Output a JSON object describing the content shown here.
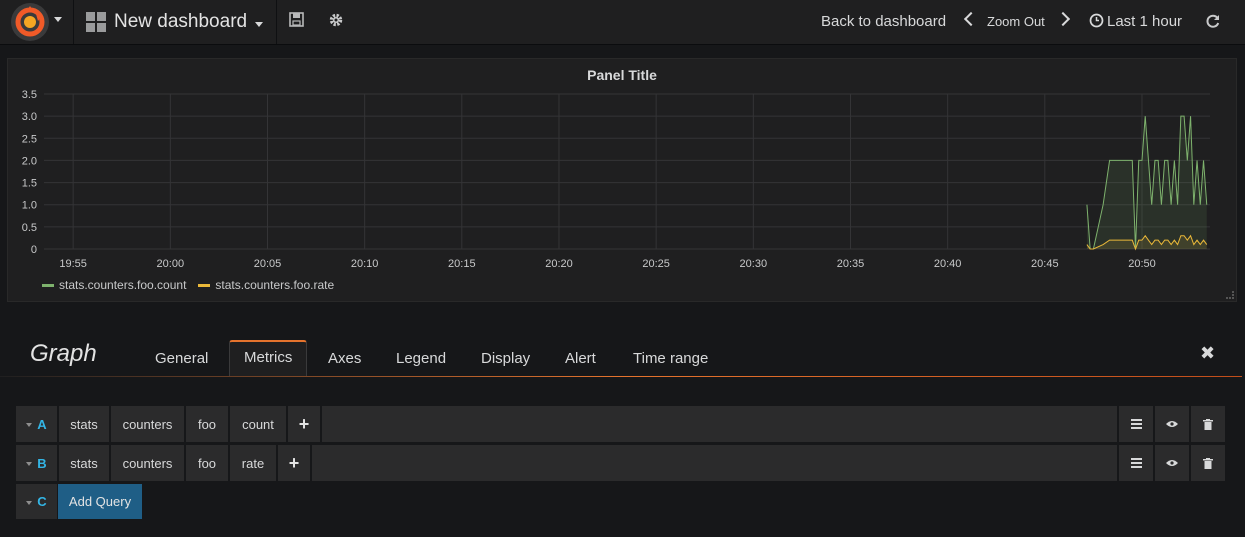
{
  "navbar": {
    "dashboard_title": "New dashboard",
    "back_to_dashboard": "Back to dashboard",
    "zoom_out": "Zoom Out",
    "time_range": "Last 1 hour"
  },
  "panel": {
    "title": "Panel Title"
  },
  "chart_data": {
    "type": "line",
    "title": "Panel Title",
    "xlabel": "",
    "ylabel": "",
    "x_ticks": [
      "19:55",
      "20:00",
      "20:05",
      "20:10",
      "20:15",
      "20:20",
      "20:25",
      "20:30",
      "20:35",
      "20:40",
      "20:45",
      "20:50"
    ],
    "y_ticks": [
      "0",
      "0.5",
      "1.0",
      "1.5",
      "2.0",
      "2.5",
      "3.0",
      "3.5"
    ],
    "ylim": [
      0,
      3.5
    ],
    "xlim": [
      "19:53:30",
      "20:53:30"
    ],
    "grid": true,
    "legend_position": "bottom-left",
    "series": [
      {
        "name": "stats.counters.foo.count",
        "color": "#7eb26d",
        "x": [
          "20:47:10",
          "20:47:20",
          "20:47:30",
          "20:48:00",
          "20:48:20",
          "20:48:30",
          "20:49:00",
          "20:49:30",
          "20:49:40",
          "20:49:50",
          "20:50:00",
          "20:50:10",
          "20:50:20",
          "20:50:30",
          "20:50:40",
          "20:50:50",
          "20:51:00",
          "20:51:10",
          "20:51:20",
          "20:51:30",
          "20:51:40",
          "20:51:50",
          "20:52:00",
          "20:52:10",
          "20:52:20",
          "20:52:30",
          "20:52:40",
          "20:52:50",
          "20:53:00",
          "20:53:10",
          "20:53:20"
        ],
        "y": [
          1,
          0,
          0,
          1,
          2,
          2,
          2,
          2,
          0,
          2,
          2,
          3,
          2,
          1,
          2,
          2,
          1,
          2,
          2,
          1,
          2,
          1,
          3,
          3,
          2,
          3,
          1,
          2,
          1,
          2,
          1
        ]
      },
      {
        "name": "stats.counters.foo.rate",
        "color": "#eab839",
        "x": [
          "20:47:10",
          "20:47:20",
          "20:47:30",
          "20:48:00",
          "20:48:20",
          "20:48:30",
          "20:49:00",
          "20:49:30",
          "20:49:40",
          "20:49:50",
          "20:50:00",
          "20:50:10",
          "20:50:20",
          "20:50:30",
          "20:50:40",
          "20:50:50",
          "20:51:00",
          "20:51:10",
          "20:51:20",
          "20:51:30",
          "20:51:40",
          "20:51:50",
          "20:52:00",
          "20:52:10",
          "20:52:20",
          "20:52:30",
          "20:52:40",
          "20:52:50",
          "20:53:00",
          "20:53:10",
          "20:53:20"
        ],
        "y": [
          0.1,
          0,
          0,
          0.1,
          0.2,
          0.2,
          0.2,
          0.2,
          0,
          0.2,
          0.2,
          0.3,
          0.2,
          0.1,
          0.2,
          0.2,
          0.1,
          0.2,
          0.2,
          0.1,
          0.2,
          0.1,
          0.3,
          0.3,
          0.2,
          0.3,
          0.1,
          0.2,
          0.1,
          0.2,
          0.1
        ]
      }
    ]
  },
  "editor": {
    "title": "Graph",
    "tabs": [
      "General",
      "Metrics",
      "Axes",
      "Legend",
      "Display",
      "Alert",
      "Time range"
    ],
    "active_tab": "Metrics"
  },
  "queries": [
    {
      "letter": "A",
      "segments": [
        "stats",
        "counters",
        "foo",
        "count"
      ]
    },
    {
      "letter": "B",
      "segments": [
        "stats",
        "counters",
        "foo",
        "rate"
      ]
    }
  ],
  "next_query_letter": "C",
  "add_query_label": "Add Query",
  "icons": {
    "logo": "grafana-logo",
    "dashboard": "grid-icon",
    "save": "save-icon",
    "settings": "gear-icon",
    "time": "clock-icon",
    "refresh": "refresh-icon",
    "close": "close-icon",
    "row_menu": "hamburger-icon",
    "toggle": "eye-icon",
    "delete": "trash-icon"
  }
}
